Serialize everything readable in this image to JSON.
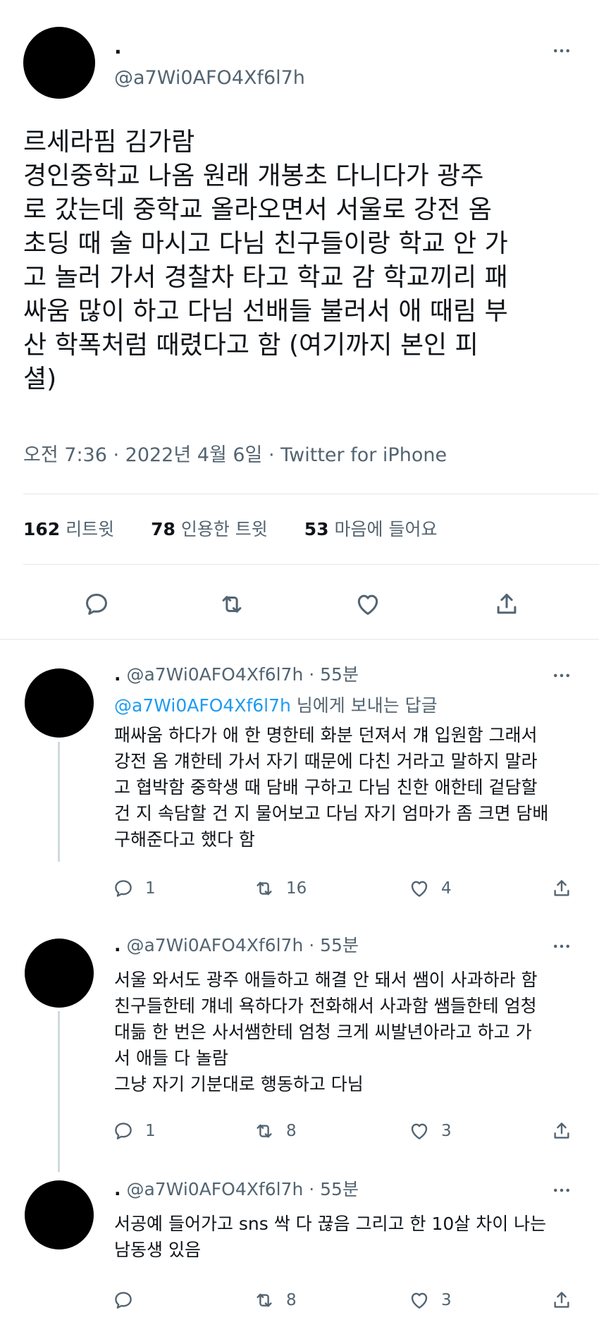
{
  "main_tweet": {
    "display_name": ".",
    "handle": "@a7Wi0AFO4Xf6l7h",
    "text": "르세라핌 김가람\n경인중학교 나옴 원래 개봉초 다니다가 광주\n로 갔는데 중학교 올라오면서 서울로 강전 옴\n초딩 때 술 마시고 다님 친구들이랑 학교 안 가\n고 놀러 가서 경찰차 타고 학교 감 학교끼리 패\n싸움 많이 하고 다님 선배들 불러서 애 때림 부\n산 학폭처럼 때렸다고 함 (여기까지 본인 피\n셜)",
    "timestamp": "오전 7:36 · 2022년 4월 6일 · Twitter for iPhone",
    "stats": [
      {
        "count": "162",
        "label": "리트윗"
      },
      {
        "count": "78",
        "label": "인용한 트윗"
      },
      {
        "count": "53",
        "label": "마음에 들어요"
      }
    ],
    "actions": [
      "reply-icon",
      "retweet-icon",
      "like-icon",
      "share-icon"
    ]
  },
  "replies": [
    {
      "display_name": ".",
      "handle": "@a7Wi0AFO4Xf6l7h",
      "separator": "·",
      "time": "55분",
      "replying_mention": "@a7Wi0AFO4Xf6l7h",
      "replying_suffix": " 님에게 보내는 답글",
      "text": "패싸움 하다가 애 한 명한테 화분 던져서 걔 입원함 그래서\n강전 옴 걔한테 가서 자기 때문에 다친 거라고 말하지 말라\n고 협박함 중학생 때 담배 구하고 다님 친한 애한테 겉담할\n건 지 속담할 건 지 물어보고 다님 자기 엄마가 좀 크면 담배\n구해준다고 했다 함",
      "counts": {
        "reply": "1",
        "retweet": "16",
        "like": "4"
      }
    },
    {
      "display_name": ".",
      "handle": "@a7Wi0AFO4Xf6l7h",
      "separator": "·",
      "time": "55분",
      "text": "서울 와서도 광주 애들하고 해결 안 돼서 쌤이 사과하라 함\n친구들한테 걔네 욕하다가 전화해서 사과함 쌤들한테 엄청\n대듦 한 번은 사서쌤한테 엄청 크게 씨발년아라고 하고 가\n서 애들 다 놀람\n그냥 자기 기분대로 행동하고 다님",
      "counts": {
        "reply": "1",
        "retweet": "8",
        "like": "3"
      }
    },
    {
      "display_name": ".",
      "handle": "@a7Wi0AFO4Xf6l7h",
      "separator": "·",
      "time": "55분",
      "text": "서공예 들어가고 sns 싹 다 끊음 그리고 한 10살 차이 나는\n남동생 있음",
      "counts": {
        "reply": "",
        "retweet": "8",
        "like": "3"
      }
    }
  ],
  "colors": {
    "text": "#0f1419",
    "secondary": "#536471",
    "link": "#1d9bf0",
    "divider": "#e1e8ed"
  }
}
